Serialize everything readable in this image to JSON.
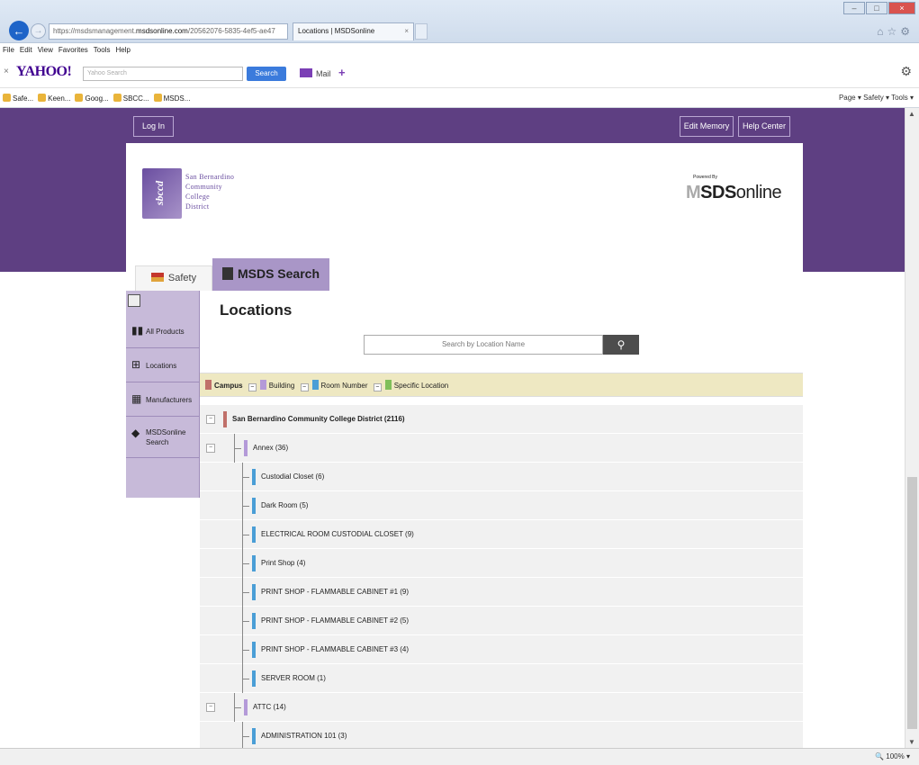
{
  "browser": {
    "url_prefix": "https://msdsmanagement.",
    "url_domain": "msdsonline.com",
    "url_rest": "/20562076-5835-4ef5-ae47",
    "tab_title": "Locations | MSDSonline",
    "menu": [
      "File",
      "Edit",
      "View",
      "Favorites",
      "Tools",
      "Help"
    ],
    "yahoo_logo": "YAHOO!",
    "yahoo_search_placeholder": "Yahoo Search",
    "yahoo_search_btn": "Search",
    "yahoo_mail": "Mail",
    "favorites": [
      "Safe...",
      "Keen...",
      "Goog...",
      "SBCC...",
      "MSDS..."
    ],
    "command_bar": "Page ▾  Safety ▾  Tools ▾",
    "zoom": "100%"
  },
  "header": {
    "login": "Log In",
    "edit_memory": "Edit Memory",
    "help_center": "Help Center",
    "district_logo_lines": [
      "San Bernardino",
      "Community",
      "College",
      "District"
    ],
    "district_logo_mark": "sbccd",
    "powered_by": "Powered By",
    "msds_brand_bold": "SDS",
    "msds_brand_rest": "online"
  },
  "tabs": {
    "safety_center": "Safety Center",
    "msds_search": "MSDS Search"
  },
  "sidebar": {
    "items": [
      {
        "label": "All Products",
        "icon": "books-icon"
      },
      {
        "label": "Locations",
        "icon": "locations-icon"
      },
      {
        "label": "Manufacturers",
        "icon": "factory-icon"
      },
      {
        "label": "MSDSonline Search",
        "icon": "msds-diamond-icon"
      }
    ]
  },
  "main": {
    "title": "Locations",
    "search_placeholder": "Search by Location Name",
    "legend": [
      {
        "label": "Campus",
        "color": "#c0706a"
      },
      {
        "label": "Building",
        "color": "#b49ad8"
      },
      {
        "label": "Room Number",
        "color": "#4a9ed6"
      },
      {
        "label": "Specific Location",
        "color": "#7fbf5a"
      }
    ],
    "tree": [
      {
        "level": 0,
        "label": "San Bernardino Community College District (2116)",
        "toggle": "−"
      },
      {
        "level": 1,
        "label": "Annex (36)",
        "toggle": "−"
      },
      {
        "level": 2,
        "label": "Custodial Closet (6)"
      },
      {
        "level": 2,
        "label": "Dark Room (5)"
      },
      {
        "level": 2,
        "label": "ELECTRICAL ROOM CUSTODIAL CLOSET (9)"
      },
      {
        "level": 2,
        "label": "Print Shop (4)"
      },
      {
        "level": 2,
        "label": "PRINT SHOP - FLAMMABLE CABINET #1 (9)"
      },
      {
        "level": 2,
        "label": "PRINT SHOP - FLAMMABLE CABINET #2 (5)"
      },
      {
        "level": 2,
        "label": "PRINT SHOP - FLAMMABLE CABINET #3 (4)"
      },
      {
        "level": 2,
        "label": "SERVER ROOM (1)"
      },
      {
        "level": 1,
        "label": "ATTC (14)",
        "toggle": "−"
      },
      {
        "level": 2,
        "label": "ADMINISTRATION 101 (3)"
      }
    ]
  }
}
